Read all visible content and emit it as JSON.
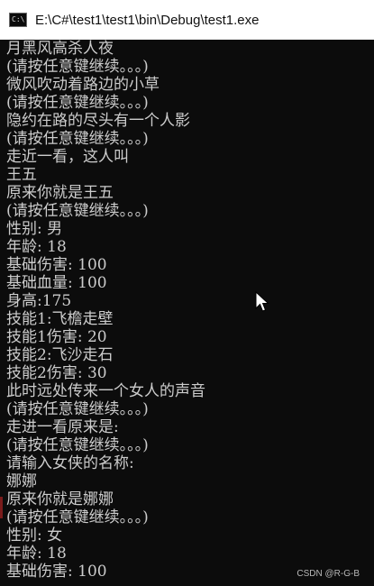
{
  "window": {
    "title": "E:\\C#\\test1\\test1\\bin\\Debug\\test1.exe",
    "icon": "console-app-icon",
    "icon_glyph": "C:\\"
  },
  "console": {
    "lines": [
      "月黑风高杀人夜",
      "(请按任意键继续。。。)",
      "微风吹动着路边的小草",
      "(请按任意键继续。。。)",
      "隐约在路的尽头有一个人影",
      "(请按任意键继续。。。)",
      "走近一看，这人叫",
      "王五",
      "原来你就是王五",
      "(请按任意键继续。。。)",
      "性别: 男",
      "年龄: 18",
      "基础伤害: 100",
      "基础血量: 100",
      "身高:175",
      "技能1:飞檐走壁",
      "技能1伤害: 20",
      "技能2:飞沙走石",
      "技能2伤害: 30",
      "此时远处传来一个女人的声音",
      "(请按任意键继续。。。)",
      "走进一看原来是:",
      "(请按任意键继续。。。)",
      "请输入女侠的名称:",
      "娜娜",
      "原来你就是娜娜",
      "(请按任意键继续。。。)",
      "性别: 女",
      "年龄: 18",
      "基础伤害: 100"
    ]
  },
  "watermark": "CSDN @R-G-B",
  "colors": {
    "console_bg": "#0c0c0c",
    "console_text": "#cccccc",
    "titlebar_bg": "#ffffff"
  }
}
